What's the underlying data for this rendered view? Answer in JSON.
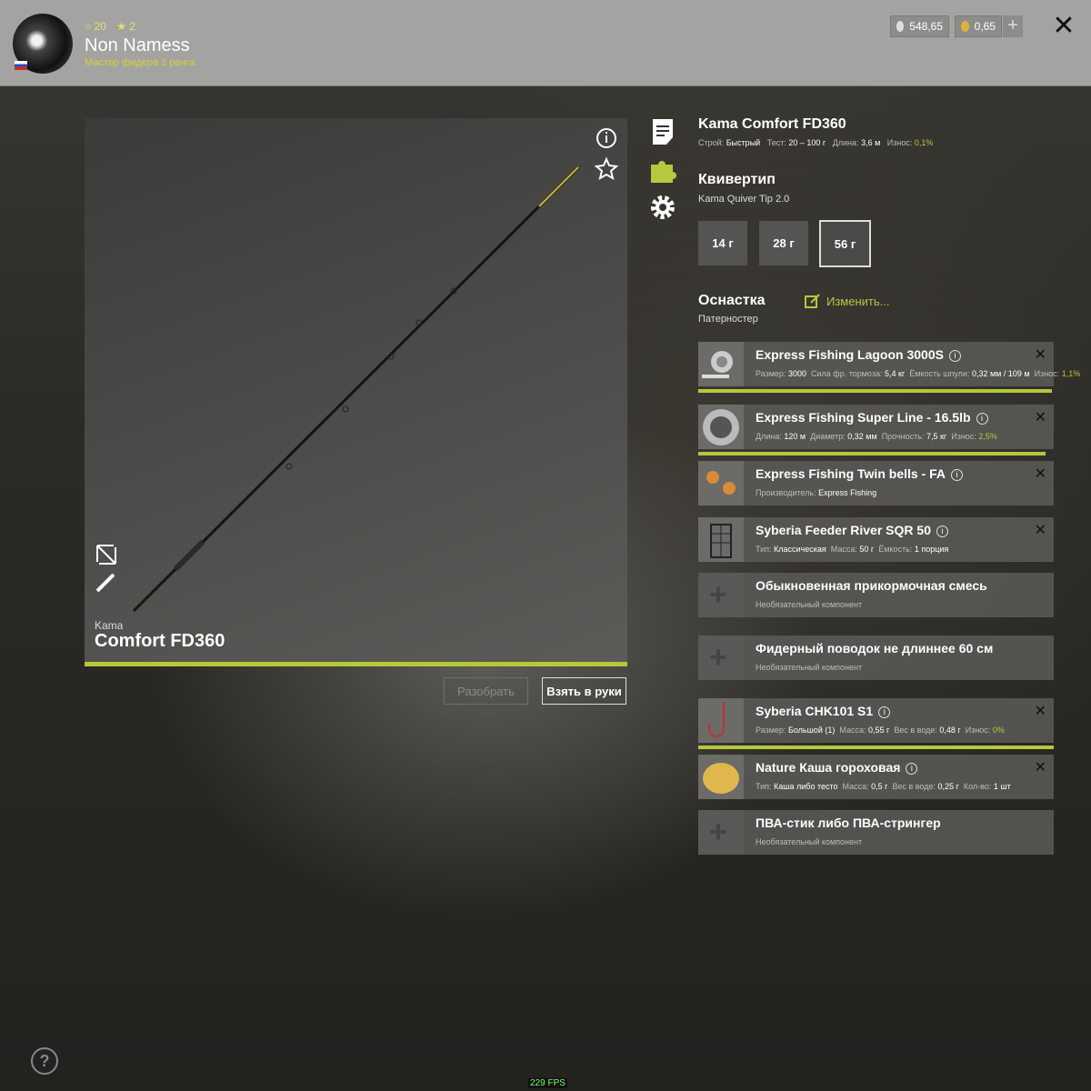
{
  "header": {
    "stat_coins": "20",
    "stat_stars": "2",
    "username": "Non Namess",
    "rank": "Мастер фидера 2 ранга",
    "silver": "548,65",
    "gold": "0,65",
    "plus": "+",
    "close": "✕"
  },
  "rod": {
    "brand": "Kama",
    "model": "Comfort FD360",
    "title": "Kama Comfort FD360",
    "spec_action_label": "Строй:",
    "spec_action": "Быстрый",
    "spec_test_label": "Тест:",
    "spec_test": "20 – 100 г",
    "spec_length_label": "Длина:",
    "spec_length": "3,6 м",
    "spec_wear_label": "Износ:",
    "spec_wear": "0,1%",
    "btn_disassemble": "Разобрать",
    "btn_take": "Взять в руки"
  },
  "quivertip": {
    "heading": "Квивертип",
    "name": "Kama Quiver Tip 2.0",
    "options": [
      "14 г",
      "28 г",
      "56 г"
    ],
    "selected_index": 2
  },
  "rig": {
    "heading": "Оснастка",
    "type": "Патерностер",
    "edit": "Изменить..."
  },
  "components": [
    {
      "title": "Express Fishing Lagoon 3000S",
      "sub": [
        [
          "Размер:",
          "3000"
        ],
        [
          "Сила фр. тормоза:",
          "5,4 кг"
        ],
        [
          "Ёмкость шпули:",
          "0,32 мм / 109 м"
        ],
        [
          "Износ:",
          "1,1%"
        ]
      ]
    },
    {
      "title": "Express Fishing Super Line - 16.5lb",
      "sub": [
        [
          "Длина:",
          "120 м"
        ],
        [
          "Диаметр:",
          "0,32 мм"
        ],
        [
          "Прочность:",
          "7,5 кг"
        ],
        [
          "Износ:",
          "2,5%"
        ]
      ]
    },
    {
      "title": "Express Fishing Twin bells - FA",
      "sub": [
        [
          "Производитель:",
          "Express Fishing"
        ]
      ]
    },
    {
      "title": "Syberia Feeder River SQR 50",
      "sub": [
        [
          "Тип:",
          "Классическая"
        ],
        [
          "Масса:",
          "50 г"
        ],
        [
          "Ёмкость:",
          "1 порция"
        ]
      ]
    },
    {
      "title": "Обыкновенная прикормочная смесь",
      "sub_text": "Необязательный компонент"
    },
    {
      "title": "Фидерный поводок не длиннее 60 см",
      "sub_text": "Необязательный компонент"
    },
    {
      "title": "Syberia CHK101 S1",
      "sub": [
        [
          "Размер:",
          "Большой (1)"
        ],
        [
          "Масса:",
          "0,55 г"
        ],
        [
          "Вес в воде:",
          "0,48 г"
        ],
        [
          "Износ:",
          "0%"
        ]
      ]
    },
    {
      "title": "Nature Каша гороховая",
      "sub": [
        [
          "Тип:",
          "Каша либо тесто"
        ],
        [
          "Масса:",
          "0,5 г"
        ],
        [
          "Вес в воде:",
          "0,25 г"
        ],
        [
          "Кол-во:",
          "1 шт"
        ]
      ]
    },
    {
      "title": "ПВА-стик либо ПВА-стрингер",
      "sub_text": "Необязательный компонент"
    }
  ],
  "footer": {
    "help": "?",
    "fps": "229 FPS"
  },
  "icons": {
    "info": "info-icon",
    "star": "star-icon",
    "expand": "expand-icon",
    "pencil": "pencil-icon",
    "description": "document-icon",
    "parts": "puzzle-icon",
    "settings": "gear-icon"
  },
  "colors": {
    "accent": "#b6c83c",
    "header": "#a3a3a1"
  }
}
